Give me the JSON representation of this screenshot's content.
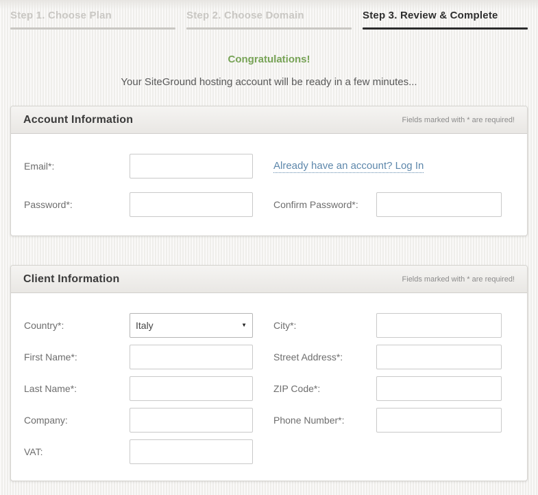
{
  "steps": [
    {
      "label": "Step 1. Choose Plan",
      "state": "inactive"
    },
    {
      "label": "Step 2. Choose Domain",
      "state": "inactive"
    },
    {
      "label": "Step 3. Review & Complete",
      "state": "active"
    }
  ],
  "banner": {
    "title": "Congratulations!",
    "subtitle": "Your SiteGround hosting account will be ready in a few minutes..."
  },
  "account_section": {
    "title": "Account Information",
    "required_note": "Fields marked with * are required!",
    "email_label": "Email*:",
    "email_value": "",
    "login_link": "Already have an account? Log In",
    "password_label": "Password*:",
    "password_value": "",
    "confirm_password_label": "Confirm Password*:",
    "confirm_password_value": ""
  },
  "client_section": {
    "title": "Client Information",
    "required_note": "Fields marked with * are required!",
    "country_label": "Country*:",
    "country_value": "Italy",
    "city_label": "City*:",
    "city_value": "",
    "first_name_label": "First Name*:",
    "first_name_value": "",
    "street_address_label": "Street Address*:",
    "street_address_value": "",
    "last_name_label": "Last Name*:",
    "last_name_value": "",
    "zip_code_label": "ZIP Code*:",
    "zip_code_value": "",
    "company_label": "Company:",
    "company_value": "",
    "phone_label": "Phone Number*:",
    "phone_value": "",
    "vat_label": "VAT:",
    "vat_value": ""
  },
  "icons": {
    "dropdown_arrow": "▼"
  },
  "colors": {
    "accent_green": "#77a356",
    "link_blue": "#5d87ab",
    "active_tab": "#2b2b2b",
    "inactive_tab": "#c9c7c3"
  }
}
